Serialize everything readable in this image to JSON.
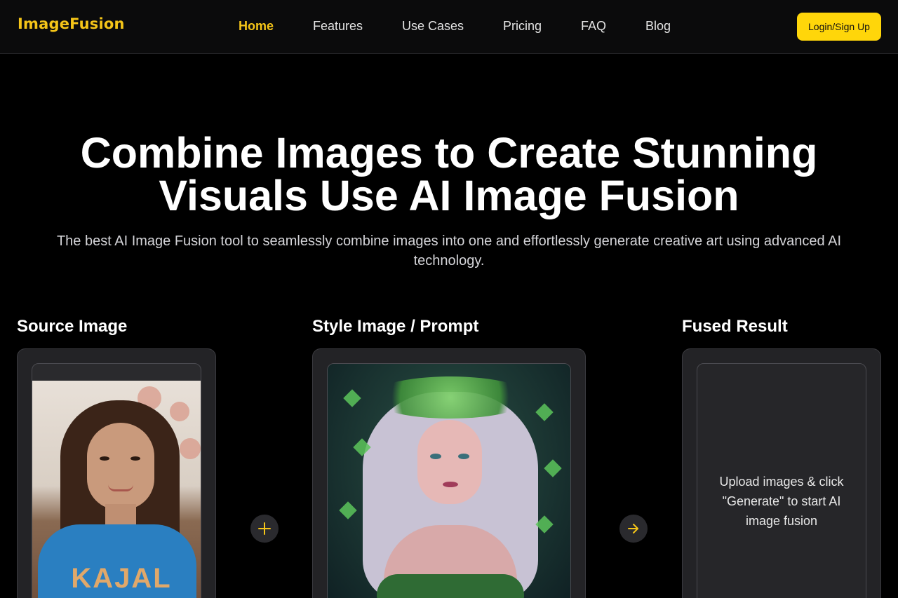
{
  "header": {
    "logo": "ImageFusion",
    "nav": [
      {
        "label": "Home",
        "active": true
      },
      {
        "label": "Features",
        "active": false
      },
      {
        "label": "Use Cases",
        "active": false
      },
      {
        "label": "Pricing",
        "active": false
      },
      {
        "label": "FAQ",
        "active": false
      },
      {
        "label": "Blog",
        "active": false
      }
    ],
    "login_label": "Login/Sign Up"
  },
  "hero": {
    "title_line1": "Combine Images to Create Stunning",
    "title_line2": "Visuals Use AI Image Fusion",
    "subtitle": "The best AI Image Fusion tool to seamlessly combine images into one and effortlessly generate creative art using advanced AI technology."
  },
  "workspace": {
    "source": {
      "title": "Source Image",
      "shirt_text": "KAJAL"
    },
    "style": {
      "title": "Style Image / Prompt"
    },
    "result": {
      "title": "Fused Result",
      "placeholder": "Upload images & click \"Generate\" to start AI image fusion"
    },
    "plus_icon": "plus-icon",
    "arrow_icon": "arrow-right-icon"
  },
  "colors": {
    "accent": "#f5c518",
    "button": "#ffd60a",
    "background": "#000000",
    "panel": "#232326"
  }
}
